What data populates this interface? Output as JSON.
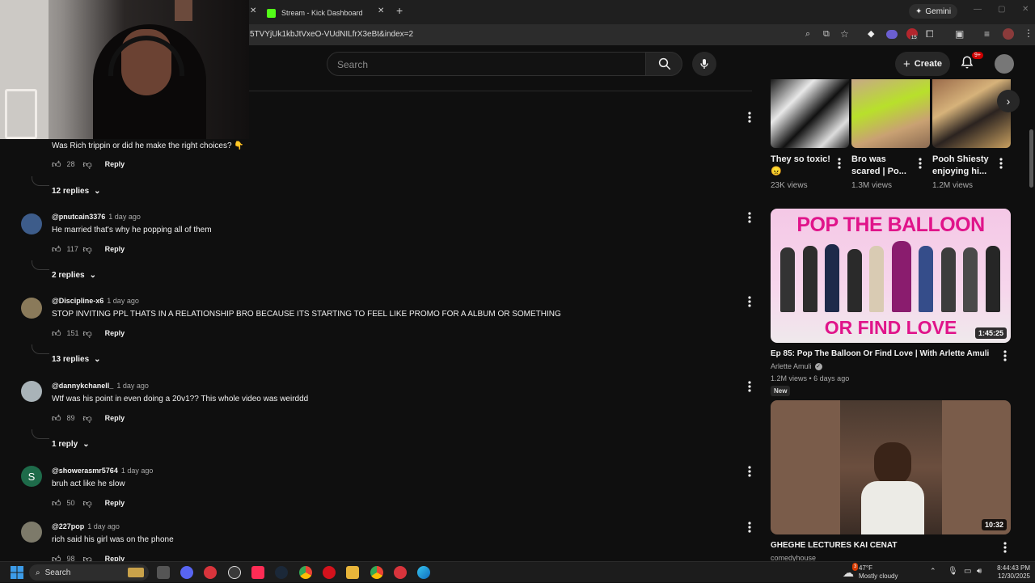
{
  "browser": {
    "tabs": [
      {
        "label": "Stream - Kick Dashboard"
      }
    ],
    "url": "5TVYjUk1kbJtVxeO-VUdNILfrX3eBt&index=2",
    "gemini_label": "Gemini",
    "extension_badge": "15"
  },
  "header": {
    "search_placeholder": "Search",
    "create_label": "Create",
    "notifications_badge": "9+"
  },
  "comments": [
    {
      "text": "Was Rich trippin or did he make the right choices? 👇",
      "likes": "28",
      "reply_label": "Reply",
      "replies_label": "12 replies"
    },
    {
      "handle": "@pnutcain3376",
      "time": "1 day ago",
      "text": "He married that's why he popping all of them",
      "likes": "117",
      "reply_label": "Reply",
      "replies_label": "2 replies"
    },
    {
      "handle": "@Discipline-x6",
      "time": "1 day ago",
      "text": "STOP INVITING PPL THATS IN A RELATIONSHIP BRO BECAUSE ITS STARTING TO FEEL LIKE PROMO FOR A ALBUM OR SOMETHING",
      "likes": "151",
      "reply_label": "Reply",
      "replies_label": "13 replies"
    },
    {
      "handle": "@dannykchanell_",
      "time": "1 day ago",
      "text": "Wtf was his point in even doing a 20v1?? This whole video was weirddd",
      "likes": "89",
      "reply_label": "Reply",
      "replies_label": "1 reply"
    },
    {
      "handle": "@showerasmr5764",
      "time": "1 day ago",
      "text": "bruh act like he slow",
      "likes": "50",
      "reply_label": "Reply",
      "avatar_letter": "S"
    },
    {
      "handle": "@227pop",
      "time": "1 day ago",
      "text": "rich said his girl was on the phone",
      "likes": "98",
      "reply_label": "Reply"
    }
  ],
  "shorts": [
    {
      "title": "They so toxic! 😠",
      "views": "23K views"
    },
    {
      "title": "Bro was scared | Po...",
      "views": "1.3M views"
    },
    {
      "title": "Pooh Shiesty enjoying hi...",
      "views": "1.2M views"
    }
  ],
  "videos": [
    {
      "thumb_text_top": "POP THE BALLOON",
      "thumb_text_bottom": "OR FIND LOVE",
      "duration": "1:45:25",
      "title": "Ep 85: Pop The Balloon Or Find Love | With Arlette Amuli",
      "channel": "Arlette Amuli",
      "meta": "1.2M views • 6 days ago",
      "badge": "New"
    },
    {
      "duration": "10:32",
      "title": "GHEGHE LECTURES KAI CENAT",
      "channel": "comedyhouse"
    }
  ],
  "taskbar": {
    "search_label": "Search",
    "weather_temp": "47°F",
    "weather_desc": "Mostly cloudy",
    "weather_badge": "3",
    "time": "8:44:43 PM",
    "date": "12/30/2025"
  },
  "colors": {
    "background": "#0f0f0f",
    "accent_red": "#cc0000",
    "kick_green": "#53fc18"
  }
}
